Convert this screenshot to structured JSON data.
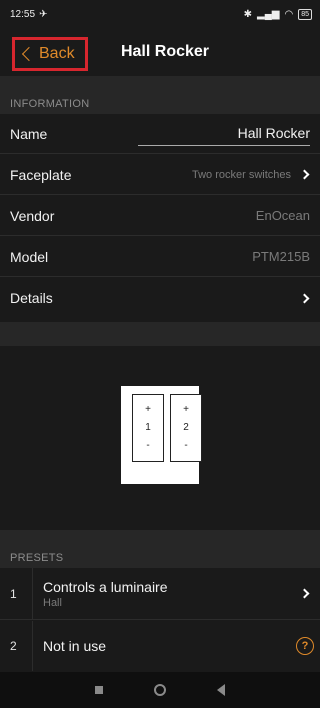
{
  "status": {
    "time": "12:55",
    "battery": "85"
  },
  "nav": {
    "back_label": "Back",
    "title": "Hall Rocker"
  },
  "information": {
    "header": "INFORMATION",
    "rows": [
      {
        "label": "Name",
        "value": "Hall Rocker"
      },
      {
        "label": "Faceplate",
        "value": "Two rocker switches"
      },
      {
        "label": "Vendor",
        "value": "EnOcean"
      },
      {
        "label": "Model",
        "value": "PTM215B"
      },
      {
        "label": "Details",
        "value": ""
      }
    ]
  },
  "faceplate_image": {
    "rockers": [
      {
        "top": "+",
        "num": "1",
        "bottom": "-"
      },
      {
        "top": "+",
        "num": "2",
        "bottom": "-"
      }
    ]
  },
  "presets": {
    "header": "PRESETS",
    "items": [
      {
        "num": "1",
        "title": "Controls a luminaire",
        "subtitle": "Hall"
      },
      {
        "num": "2",
        "title": "Not in use",
        "subtitle": ""
      }
    ]
  },
  "icons": {
    "accent": "#e08a2a",
    "highlight": "#d7262e"
  }
}
